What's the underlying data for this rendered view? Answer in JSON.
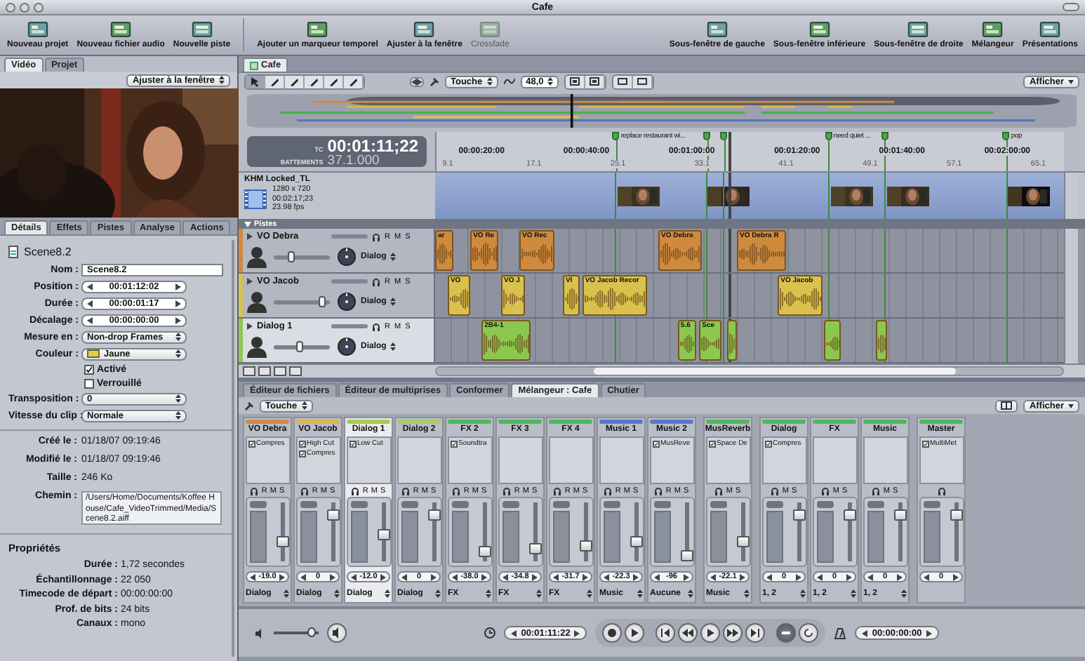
{
  "window": {
    "title": "Cafe"
  },
  "toolbar": {
    "left": [
      {
        "label": "Nouveau projet",
        "disabled": false
      },
      {
        "label": "Nouveau fichier audio",
        "disabled": false
      },
      {
        "label": "Nouvelle piste",
        "disabled": false
      },
      {
        "label": "Ajouter un marqueur temporel",
        "disabled": false
      },
      {
        "label": "Ajuster à la fenêtre",
        "disabled": false
      },
      {
        "label": "Crossfade",
        "disabled": true
      }
    ],
    "right": [
      {
        "label": "Sous-fenêtre de gauche",
        "disabled": false
      },
      {
        "label": "Sous-fenêtre inférieure",
        "disabled": false
      },
      {
        "label": "Sous-fenêtre de droite",
        "disabled": false
      },
      {
        "label": "Mélangeur",
        "disabled": false
      },
      {
        "label": "Présentations",
        "disabled": false
      }
    ]
  },
  "left_panel": {
    "tabs": [
      {
        "label": "Vidéo",
        "selected": true
      },
      {
        "label": "Projet",
        "selected": false
      }
    ],
    "zoom_select": "Ajuster à la fenêtre",
    "inspector_tabs": [
      {
        "label": "Détails",
        "selected": true
      },
      {
        "label": "Effets",
        "selected": false
      },
      {
        "label": "Pistes",
        "selected": false
      },
      {
        "label": "Analyse",
        "selected": false
      },
      {
        "label": "Actions",
        "selected": false
      }
    ],
    "file_name": "Scene8.2",
    "fields": [
      {
        "label": "Nom :",
        "value": "Scene8.2",
        "kind": "text"
      },
      {
        "label": "Position :",
        "value": "00:01:12:02",
        "kind": "stepper"
      },
      {
        "label": "Durée :",
        "value": "00:00:01:17",
        "kind": "stepper"
      },
      {
        "label": "Décalage :",
        "value": "00:00:00:00",
        "kind": "stepper"
      },
      {
        "label": "Mesure en :",
        "value": "Non-drop Frames",
        "kind": "select"
      },
      {
        "label": "Couleur :",
        "value": "Jaune",
        "kind": "color",
        "color": "#e2cf3c"
      }
    ],
    "checkboxes": [
      {
        "label": "Activé",
        "checked": true
      },
      {
        "label": "Verrouillé",
        "checked": false
      }
    ],
    "fields2": [
      {
        "label": "Transposition :",
        "value": "0",
        "kind": "select"
      },
      {
        "label": "Vitesse du clip :",
        "value": "Normale",
        "kind": "select"
      }
    ],
    "info": [
      {
        "label": "Créé le :",
        "value": "01/18/07  09:19:46",
        "kind": "plain"
      },
      {
        "label": "Modifié le :",
        "value": "01/18/07  09:19:46",
        "kind": "plain"
      },
      {
        "label": "Taille :",
        "value": "246 Ko",
        "kind": "plain"
      },
      {
        "label": "Chemin :",
        "value": "/Users/Home/Documents/Koffee House/Cafe_VideoTrimmed/Media/Scene8.2.aiff",
        "kind": "box"
      }
    ],
    "properties": {
      "title": "Propriétés",
      "rows": [
        {
          "label": "Durée :",
          "value": "1,72 secondes"
        },
        {
          "label": "Échantillonnage :",
          "value": "22 050"
        },
        {
          "label": "Timecode de départ :",
          "value": "00:00:00:00"
        },
        {
          "label": "Prof. de bits :",
          "value": "24 bits"
        },
        {
          "label": "Canaux :",
          "value": "mono"
        }
      ]
    }
  },
  "timeline": {
    "tab": "Cafe",
    "touch_mode": "Touche",
    "zoom_value": "48,0",
    "view_menu": "Afficher",
    "timecode_label": "TC",
    "timecode": "00:01:11;22",
    "beats_label": "BATTEMENTS",
    "beats": "37.1.000",
    "markers": [
      {
        "kind": "labeled",
        "label": "replace restaurant wi..."
      },
      {
        "kind": "plain"
      },
      {
        "kind": "plain"
      },
      {
        "kind": "labeled",
        "label": "need quiet ..."
      },
      {
        "kind": "plain"
      },
      {
        "kind": "labeled",
        "label": "pop"
      }
    ],
    "ruler_major": [
      "00:00:20:00",
      "00:00:40:00",
      "00:01:00:00",
      "00:01:20:00",
      "00:01:40:00",
      "00:02:00:00"
    ],
    "ruler_minor": [
      "9.1",
      "17.1",
      "25.1",
      "33.1",
      "41.1",
      "49.1",
      "57.1",
      "65.1"
    ],
    "video_track": {
      "name": "KHM Locked_TL",
      "size": "1280 x 720",
      "duration": "00:02:17;23",
      "rate": "23.98 fps"
    },
    "tracks_header": "Pistes",
    "tracks": [
      {
        "name": "VO Debra",
        "color": "#cf8a3e",
        "selected": false,
        "level": 0.3,
        "output": "Dialog",
        "controls": [
          "R",
          "M",
          "S"
        ],
        "clips": [
          {
            "kind": "labeled",
            "label": "ar"
          },
          {
            "kind": "labeled",
            "label": "VO Re"
          },
          {
            "kind": "labeled",
            "label": "VO Rec"
          },
          {
            "kind": "labeled",
            "label": "VO Debra"
          },
          {
            "kind": "labeled",
            "label": "VO Debra R"
          }
        ]
      },
      {
        "name": "VO Jacob",
        "color": "#d8c24e",
        "selected": false,
        "level": 0.85,
        "output": "Dialog",
        "controls": [
          "R",
          "M",
          "S"
        ],
        "clips": [
          {
            "kind": "labeled",
            "label": "VO"
          },
          {
            "kind": "labeled",
            "label": "VO J"
          },
          {
            "kind": "labeled",
            "label": "VI"
          },
          {
            "kind": "labeled",
            "label": "VO Jacob Recor"
          },
          {
            "kind": "labeled",
            "label": "VO Jacob"
          }
        ]
      },
      {
        "name": "Dialog 1",
        "color": "#8cc850",
        "selected": true,
        "level": 0.45,
        "output": "Dialog",
        "controls": [
          "R",
          "M",
          "S"
        ],
        "clips": [
          {
            "kind": "labeled",
            "label": "2B4-1"
          },
          {
            "kind": "labeled",
            "label": "5.6"
          },
          {
            "kind": "labeled",
            "label": "Sce"
          },
          {
            "kind": "plain"
          },
          {
            "kind": "plain"
          },
          {
            "kind": "plain"
          }
        ]
      }
    ]
  },
  "mixer": {
    "tabs": [
      {
        "label": "Éditeur de fichiers",
        "selected": false
      },
      {
        "label": "Éditeur de multiprises",
        "selected": false
      },
      {
        "label": "Conformer",
        "selected": false
      },
      {
        "label": "Mélangeur : Cafe",
        "selected": true
      },
      {
        "label": "Chutier",
        "selected": false
      }
    ],
    "touch_mode": "Touche",
    "view_menu": "Afficher",
    "channels": [
      {
        "name": "VO Debra",
        "color": "#d08a3e",
        "selected": false,
        "effects": [
          {
            "name": "Compres",
            "checked": true
          }
        ],
        "controls": [
          "R",
          "M",
          "S"
        ],
        "level": 0.3,
        "value": "-19.0",
        "output": "Dialog"
      },
      {
        "name": "VO Jacob",
        "color": "#d8b850",
        "selected": false,
        "effects": [
          {
            "name": "High Cut",
            "checked": true
          },
          {
            "name": "Compres",
            "checked": true
          }
        ],
        "controls": [
          "R",
          "M",
          "S"
        ],
        "level": 0.85,
        "value": "0",
        "output": "Dialog"
      },
      {
        "name": "Dialog 1",
        "color": "#a8cc50",
        "selected": true,
        "effects": [
          {
            "name": "Low Cut",
            "checked": true
          }
        ],
        "controls": [
          "R",
          "M",
          "S"
        ],
        "level": 0.45,
        "value": "-12.0",
        "output": "Dialog"
      },
      {
        "name": "Dialog 2",
        "color": "#a8cc60",
        "selected": false,
        "controls": [
          "R",
          "M",
          "S"
        ],
        "level": 0.85,
        "value": "0",
        "output": "Dialog"
      },
      {
        "name": "FX 2",
        "color": "#4fb85c",
        "selected": false,
        "effects": [
          {
            "name": "Soundtra",
            "checked": true
          }
        ],
        "controls": [
          "R",
          "M",
          "S"
        ],
        "level": 0.1,
        "value": "-38.0",
        "output": "FX"
      },
      {
        "name": "FX 3",
        "color": "#4fb85c",
        "selected": false,
        "controls": [
          "R",
          "M",
          "S"
        ],
        "level": 0.15,
        "value": "-34.8",
        "output": "FX"
      },
      {
        "name": "FX 4",
        "color": "#4fb85c",
        "selected": false,
        "controls": [
          "R",
          "M",
          "S"
        ],
        "level": 0.2,
        "value": "-31.7",
        "output": "FX"
      },
      {
        "name": "Music 1",
        "color": "#5a78c8",
        "selected": false,
        "controls": [
          "R",
          "M",
          "S"
        ],
        "level": 0.3,
        "value": "-22.3",
        "output": "Music"
      },
      {
        "name": "Music 2",
        "color": "#5a78c8",
        "selected": false,
        "effects": [
          {
            "name": "MusReve",
            "checked": true
          }
        ],
        "controls": [
          "R",
          "M",
          "S"
        ],
        "level": 0.0,
        "value": "-96",
        "output": "Aucune"
      },
      {
        "name": "MusReverb",
        "color": "#4fb85c",
        "selected": false,
        "effects": [
          {
            "name": "Space De",
            "checked": true
          }
        ],
        "controls": [
          "M",
          "S"
        ],
        "level": 0.3,
        "value": "-22.1",
        "output": "Music"
      },
      {
        "name": "Dialog",
        "color": "#4fb85c",
        "selected": false,
        "effects": [
          {
            "name": "Compres",
            "checked": true
          }
        ],
        "controls": [
          "M",
          "S"
        ],
        "level": 0.85,
        "value": "0",
        "output": "1, 2"
      },
      {
        "name": "FX",
        "color": "#4fb85c",
        "selected": false,
        "controls": [
          "M",
          "S"
        ],
        "level": 0.85,
        "value": "0",
        "output": "1, 2"
      },
      {
        "name": "Music",
        "color": "#4fb85c",
        "selected": false,
        "controls": [
          "M",
          "S"
        ],
        "level": 0.85,
        "value": "0",
        "output": "1, 2"
      },
      {
        "name": "Master",
        "color": "#4fb85c",
        "selected": false,
        "effects": [
          {
            "name": "MultiMet",
            "checked": true
          }
        ],
        "level": 0.85,
        "value": "0"
      }
    ]
  },
  "transport": {
    "level": 0.85,
    "timecode": "00:01:11:22",
    "loop_on": true,
    "secondary_timecode": "00:00:00:00"
  }
}
